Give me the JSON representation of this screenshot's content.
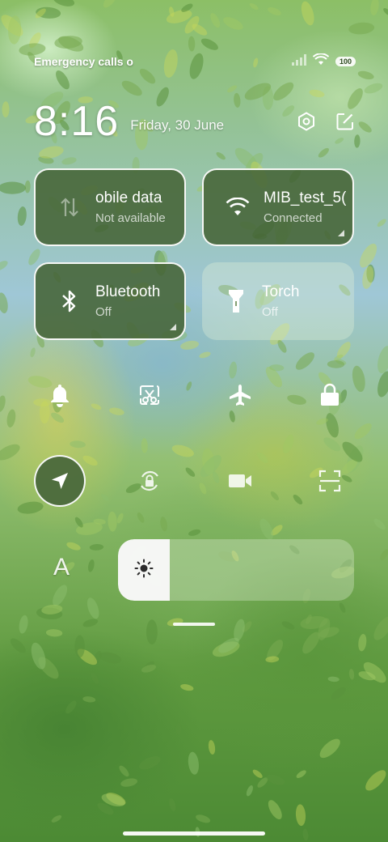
{
  "status_bar": {
    "carrier_text": "Emergency calls o",
    "battery": "100"
  },
  "header": {
    "time": "8:16",
    "date": "Friday, 30 June"
  },
  "tiles": [
    {
      "title": "obile data",
      "subtitle": "Not available",
      "icon": "mobile-data-icon",
      "active": true
    },
    {
      "title": "MIB_test_5(",
      "subtitle": "Connected",
      "icon": "wifi-icon",
      "active": true
    },
    {
      "title": "Bluetooth",
      "subtitle": "Off",
      "icon": "bluetooth-icon",
      "active": true
    },
    {
      "title": "Torch",
      "subtitle": "Off",
      "icon": "torch-icon",
      "active": false
    }
  ],
  "toggles_row1": [
    "bell-icon",
    "screenshot-icon",
    "airplane-icon",
    "lock-icon"
  ],
  "toggles_row2": [
    "location-icon",
    "rotation-lock-icon",
    "video-icon",
    "scan-icon"
  ],
  "brightness": {
    "font_label": "A",
    "level": 0.22
  },
  "colors": {
    "tile_active": "#46643a",
    "accent_white": "#ffffff"
  }
}
